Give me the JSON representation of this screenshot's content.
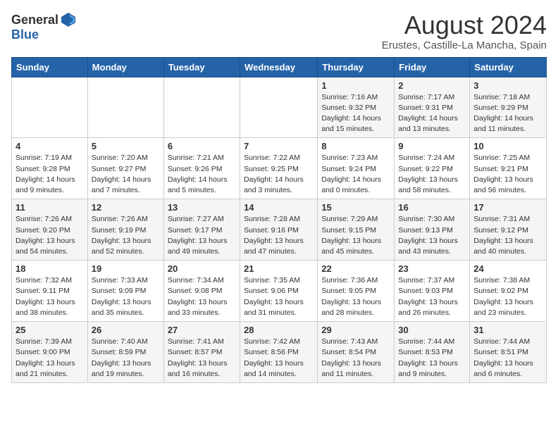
{
  "header": {
    "logo_general": "General",
    "logo_blue": "Blue",
    "month_year": "August 2024",
    "location": "Erustes, Castille-La Mancha, Spain"
  },
  "days_of_week": [
    "Sunday",
    "Monday",
    "Tuesday",
    "Wednesday",
    "Thursday",
    "Friday",
    "Saturday"
  ],
  "weeks": [
    [
      {
        "day": "",
        "info": ""
      },
      {
        "day": "",
        "info": ""
      },
      {
        "day": "",
        "info": ""
      },
      {
        "day": "",
        "info": ""
      },
      {
        "day": "1",
        "info": "Sunrise: 7:16 AM\nSunset: 9:32 PM\nDaylight: 14 hours\nand 15 minutes."
      },
      {
        "day": "2",
        "info": "Sunrise: 7:17 AM\nSunset: 9:31 PM\nDaylight: 14 hours\nand 13 minutes."
      },
      {
        "day": "3",
        "info": "Sunrise: 7:18 AM\nSunset: 9:29 PM\nDaylight: 14 hours\nand 11 minutes."
      }
    ],
    [
      {
        "day": "4",
        "info": "Sunrise: 7:19 AM\nSunset: 9:28 PM\nDaylight: 14 hours\nand 9 minutes."
      },
      {
        "day": "5",
        "info": "Sunrise: 7:20 AM\nSunset: 9:27 PM\nDaylight: 14 hours\nand 7 minutes."
      },
      {
        "day": "6",
        "info": "Sunrise: 7:21 AM\nSunset: 9:26 PM\nDaylight: 14 hours\nand 5 minutes."
      },
      {
        "day": "7",
        "info": "Sunrise: 7:22 AM\nSunset: 9:25 PM\nDaylight: 14 hours\nand 3 minutes."
      },
      {
        "day": "8",
        "info": "Sunrise: 7:23 AM\nSunset: 9:24 PM\nDaylight: 14 hours\nand 0 minutes."
      },
      {
        "day": "9",
        "info": "Sunrise: 7:24 AM\nSunset: 9:22 PM\nDaylight: 13 hours\nand 58 minutes."
      },
      {
        "day": "10",
        "info": "Sunrise: 7:25 AM\nSunset: 9:21 PM\nDaylight: 13 hours\nand 56 minutes."
      }
    ],
    [
      {
        "day": "11",
        "info": "Sunrise: 7:26 AM\nSunset: 9:20 PM\nDaylight: 13 hours\nand 54 minutes."
      },
      {
        "day": "12",
        "info": "Sunrise: 7:26 AM\nSunset: 9:19 PM\nDaylight: 13 hours\nand 52 minutes."
      },
      {
        "day": "13",
        "info": "Sunrise: 7:27 AM\nSunset: 9:17 PM\nDaylight: 13 hours\nand 49 minutes."
      },
      {
        "day": "14",
        "info": "Sunrise: 7:28 AM\nSunset: 9:16 PM\nDaylight: 13 hours\nand 47 minutes."
      },
      {
        "day": "15",
        "info": "Sunrise: 7:29 AM\nSunset: 9:15 PM\nDaylight: 13 hours\nand 45 minutes."
      },
      {
        "day": "16",
        "info": "Sunrise: 7:30 AM\nSunset: 9:13 PM\nDaylight: 13 hours\nand 43 minutes."
      },
      {
        "day": "17",
        "info": "Sunrise: 7:31 AM\nSunset: 9:12 PM\nDaylight: 13 hours\nand 40 minutes."
      }
    ],
    [
      {
        "day": "18",
        "info": "Sunrise: 7:32 AM\nSunset: 9:11 PM\nDaylight: 13 hours\nand 38 minutes."
      },
      {
        "day": "19",
        "info": "Sunrise: 7:33 AM\nSunset: 9:09 PM\nDaylight: 13 hours\nand 35 minutes."
      },
      {
        "day": "20",
        "info": "Sunrise: 7:34 AM\nSunset: 9:08 PM\nDaylight: 13 hours\nand 33 minutes."
      },
      {
        "day": "21",
        "info": "Sunrise: 7:35 AM\nSunset: 9:06 PM\nDaylight: 13 hours\nand 31 minutes."
      },
      {
        "day": "22",
        "info": "Sunrise: 7:36 AM\nSunset: 9:05 PM\nDaylight: 13 hours\nand 28 minutes."
      },
      {
        "day": "23",
        "info": "Sunrise: 7:37 AM\nSunset: 9:03 PM\nDaylight: 13 hours\nand 26 minutes."
      },
      {
        "day": "24",
        "info": "Sunrise: 7:38 AM\nSunset: 9:02 PM\nDaylight: 13 hours\nand 23 minutes."
      }
    ],
    [
      {
        "day": "25",
        "info": "Sunrise: 7:39 AM\nSunset: 9:00 PM\nDaylight: 13 hours\nand 21 minutes."
      },
      {
        "day": "26",
        "info": "Sunrise: 7:40 AM\nSunset: 8:59 PM\nDaylight: 13 hours\nand 19 minutes."
      },
      {
        "day": "27",
        "info": "Sunrise: 7:41 AM\nSunset: 8:57 PM\nDaylight: 13 hours\nand 16 minutes."
      },
      {
        "day": "28",
        "info": "Sunrise: 7:42 AM\nSunset: 8:56 PM\nDaylight: 13 hours\nand 14 minutes."
      },
      {
        "day": "29",
        "info": "Sunrise: 7:43 AM\nSunset: 8:54 PM\nDaylight: 13 hours\nand 11 minutes."
      },
      {
        "day": "30",
        "info": "Sunrise: 7:44 AM\nSunset: 8:53 PM\nDaylight: 13 hours\nand 9 minutes."
      },
      {
        "day": "31",
        "info": "Sunrise: 7:44 AM\nSunset: 8:51 PM\nDaylight: 13 hours\nand 6 minutes."
      }
    ]
  ]
}
